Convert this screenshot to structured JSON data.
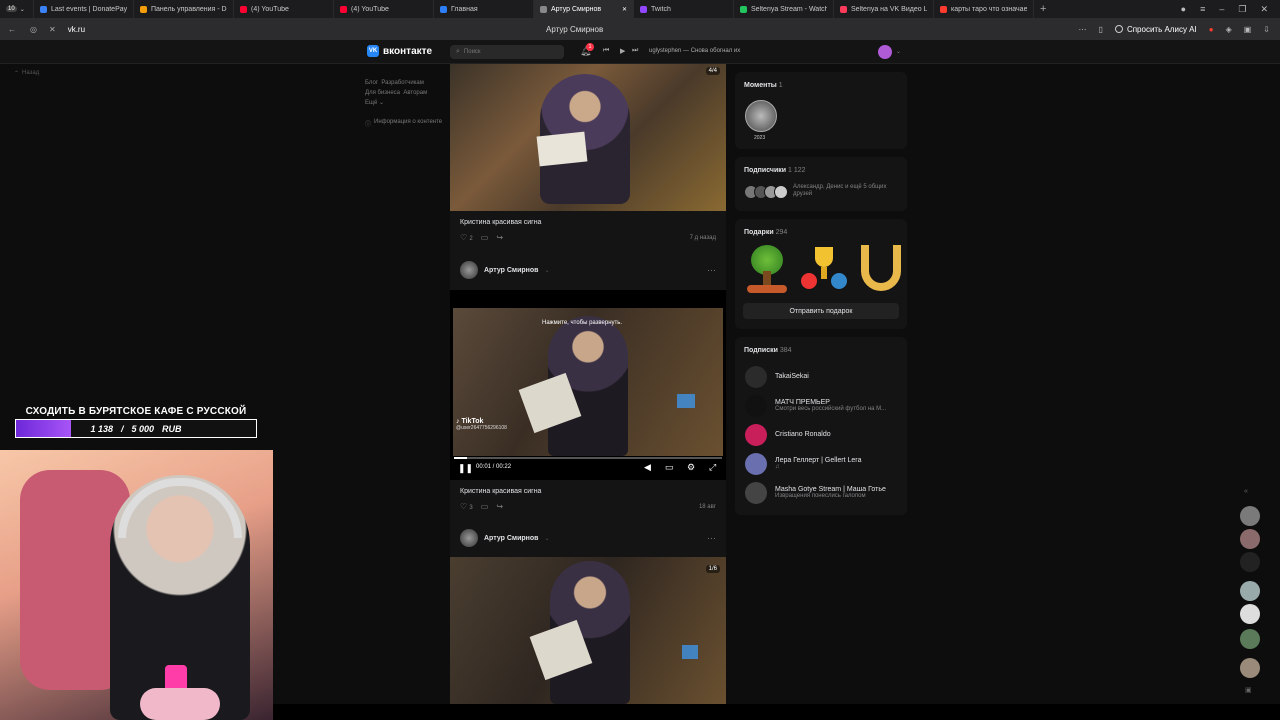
{
  "browser": {
    "tabs": [
      {
        "label": "Last events | DonatePay",
        "color": "#3b82f6"
      },
      {
        "label": "Панель управления - Do",
        "color": "#f59e0b"
      },
      {
        "label": "(4) YouTube",
        "color": "#ff0033"
      },
      {
        "label": "(4) YouTube",
        "color": "#ff0033"
      },
      {
        "label": "Главная",
        "color": "#2d7ff9"
      },
      {
        "label": "Артур Смирнов",
        "color": "#888888",
        "active": true
      },
      {
        "label": "Twitch",
        "color": "#9146ff"
      },
      {
        "label": "Selteriya Stream - Watch",
        "color": "#22c55e"
      },
      {
        "label": "Selteriya на VK Видео Liv",
        "color": "#ff3b5c"
      },
      {
        "label": "карты таро что означает",
        "color": "#ff3b30"
      }
    ],
    "tab_count_badge": "10",
    "url": "vk.ru",
    "page_title": "Артур Смирнов",
    "ask_ai": "Спросить Алису AI"
  },
  "vk": {
    "logo": "вконтакте",
    "search_placeholder": "Поиск",
    "notif_count": "1",
    "player_track": "uglystephen — Снова обогнал их",
    "back_link": "Назад",
    "left_links": [
      "Блог",
      "Разработчикам",
      "Для бизнеса",
      "Авторам",
      "Ещё"
    ],
    "content_info": "Информация о контенте"
  },
  "feed": {
    "post1": {
      "counter": "4/4",
      "caption": "Кристина красивая сигна",
      "likes": "2",
      "time": "7 д назад"
    },
    "post2": {
      "author": "Артур Смирнов",
      "overlay": "Нажмите, чтобы развернуть.",
      "tiktok": "TikTok",
      "tiktok_user": "@user2647756296108",
      "time_current": "00:01",
      "time_total": "00:22",
      "progress": 0.05,
      "caption": "Кристина красивая сигна",
      "likes": "3",
      "time": "18 авг"
    },
    "post3": {
      "author": "Артур Смирнов",
      "counter": "1/6"
    }
  },
  "sidebar": {
    "moments_title": "Моменты",
    "moments_count": "1",
    "moment_label": "2023",
    "followers_title": "Подписчики",
    "followers_count": "1 122",
    "followers_text": "Александр, Денис и ещё 5 общих друзей",
    "gifts_title": "Подарки",
    "gifts_count": "294",
    "send_gift": "Отправить подарок",
    "subs_title": "Подписки",
    "subs_count": "384",
    "subs": [
      {
        "name": "TakaiSekai",
        "sub": "",
        "color": "#2b2b2b"
      },
      {
        "name": "МАТЧ ПРЕМЬЕР",
        "sub": "Смотри весь российский футбол на М...",
        "color": "#111111"
      },
      {
        "name": "Cristiano Ronaldo",
        "sub": "",
        "color": "#c81e5a"
      },
      {
        "name": "Лера Геллерт | Gellert Lera",
        "sub": "♫",
        "color": "#6a6fb0"
      },
      {
        "name": "Masha Gotye Stream | Маша Готье",
        "sub": "Извращения понеслись галопом",
        "color": "#444444"
      }
    ]
  },
  "overlay": {
    "goal_title": "СХОДИТЬ В БУРЯТСКОЕ КАФЕ С РУССКОЙ",
    "goal_current": "1 138",
    "goal_target": "5 000",
    "goal_currency": "RUB",
    "goal_progress": 0.2276
  },
  "colors": {
    "vk_blue": "#2787f5",
    "accent_red": "#ff3347",
    "goal_purple": "#6d28d9"
  }
}
